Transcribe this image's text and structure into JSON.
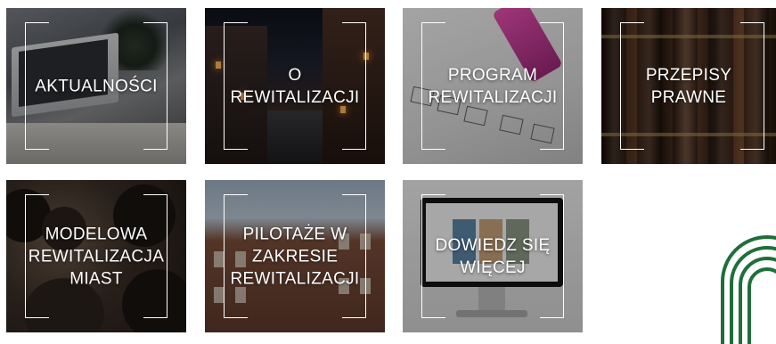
{
  "tiles": [
    {
      "lines": [
        "AKTUALNOŚCI"
      ]
    },
    {
      "lines": [
        "O",
        "REWITALIZACJI"
      ]
    },
    {
      "lines": [
        "PROGRAM",
        "REWITALIZACJI"
      ]
    },
    {
      "lines": [
        "PRZEPISY",
        "PRAWNE"
      ]
    },
    {
      "lines": [
        "MODELOWA",
        "REWITALIZACJA",
        "MIAST"
      ]
    },
    {
      "lines": [
        "PILOTAŻE W",
        "ZAKRESIE",
        "REWITALIZACJI"
      ]
    },
    {
      "lines": [
        "DOWIEDZ SIĘ",
        "WIĘCEJ"
      ]
    }
  ],
  "colors": {
    "overlay_text": "#ffffff",
    "logo_green": "#1e6f3a"
  }
}
